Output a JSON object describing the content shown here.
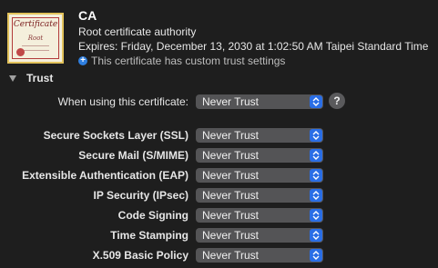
{
  "certificate": {
    "image_text": "Certificate",
    "image_sub": "Root",
    "name": "CA",
    "kind": "Root certificate authority",
    "expires": "Expires: Friday, December 13, 2030 at 1:02:50 AM Taipei Standard Time",
    "custom_trust_note": "This certificate has custom trust settings"
  },
  "trust": {
    "section_title": "Trust",
    "when_using_label": "When using this certificate:",
    "when_using_value": "Never Trust",
    "help_label": "?",
    "rows": [
      {
        "label": "Secure Sockets Layer (SSL)",
        "value": "Never Trust"
      },
      {
        "label": "Secure Mail (S/MIME)",
        "value": "Never Trust"
      },
      {
        "label": "Extensible Authentication (EAP)",
        "value": "Never Trust"
      },
      {
        "label": "IP Security (IPsec)",
        "value": "Never Trust"
      },
      {
        "label": "Code Signing",
        "value": "Never Trust"
      },
      {
        "label": "Time Stamping",
        "value": "Never Trust"
      },
      {
        "label": "X.509 Basic Policy",
        "value": "Never Trust"
      }
    ]
  },
  "colors": {
    "background": "#1e1e1e",
    "popup": "#545456",
    "accent": "#2a6ee6",
    "plus_icon": "#2f7fe0"
  }
}
